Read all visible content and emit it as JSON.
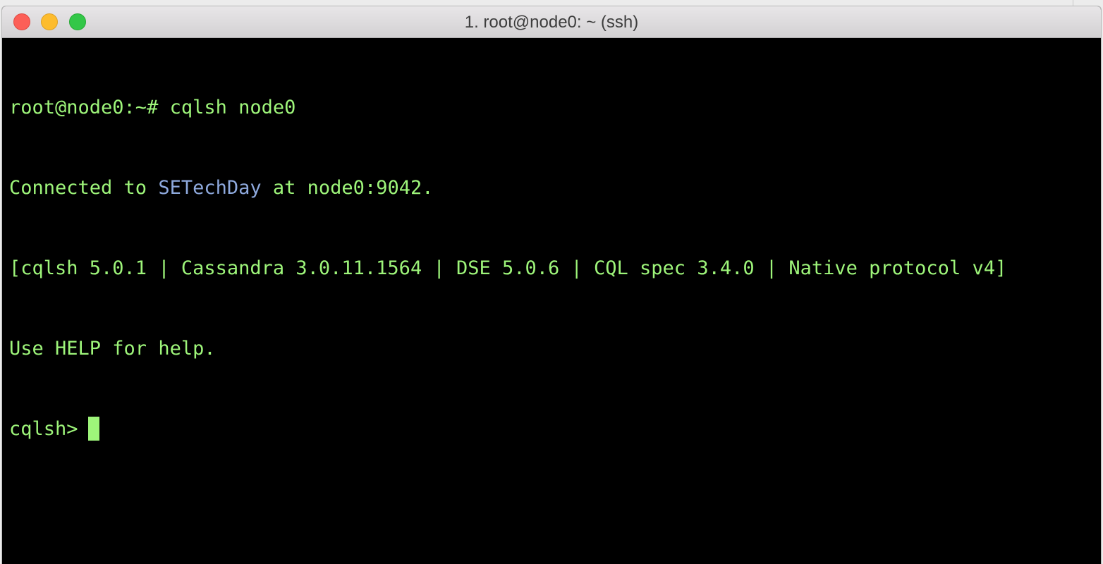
{
  "window": {
    "title": "1. root@node0: ~ (ssh)"
  },
  "terminal": {
    "line1": "root@node0:~# cqlsh node0",
    "line2_prefix": "Connected to ",
    "line2_cluster": "SETechDay",
    "line2_suffix": " at node0:9042.",
    "line3": "[cqlsh 5.0.1 | Cassandra 3.0.11.1564 | DSE 5.0.6 | CQL spec 3.4.0 | Native protocol v4]",
    "line4": "Use HELP for help.",
    "prompt": "cqlsh>"
  },
  "colors": {
    "foreground": "#9ef57a",
    "cluster_highlight": "#8ea9dd",
    "background": "#000000"
  }
}
